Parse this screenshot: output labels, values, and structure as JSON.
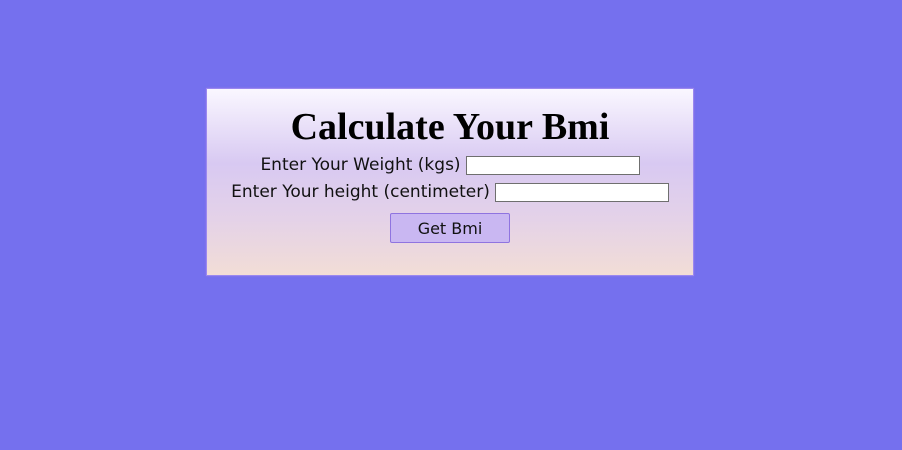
{
  "page": {
    "background_color": "#7570ee"
  },
  "form": {
    "title": "Calculate Your Bmi",
    "weight_label": "Enter Your Weight (kgs)",
    "weight_value": "",
    "height_label": "Enter Your height (centimeter)",
    "height_value": "",
    "submit_label": "Get Bmi"
  }
}
